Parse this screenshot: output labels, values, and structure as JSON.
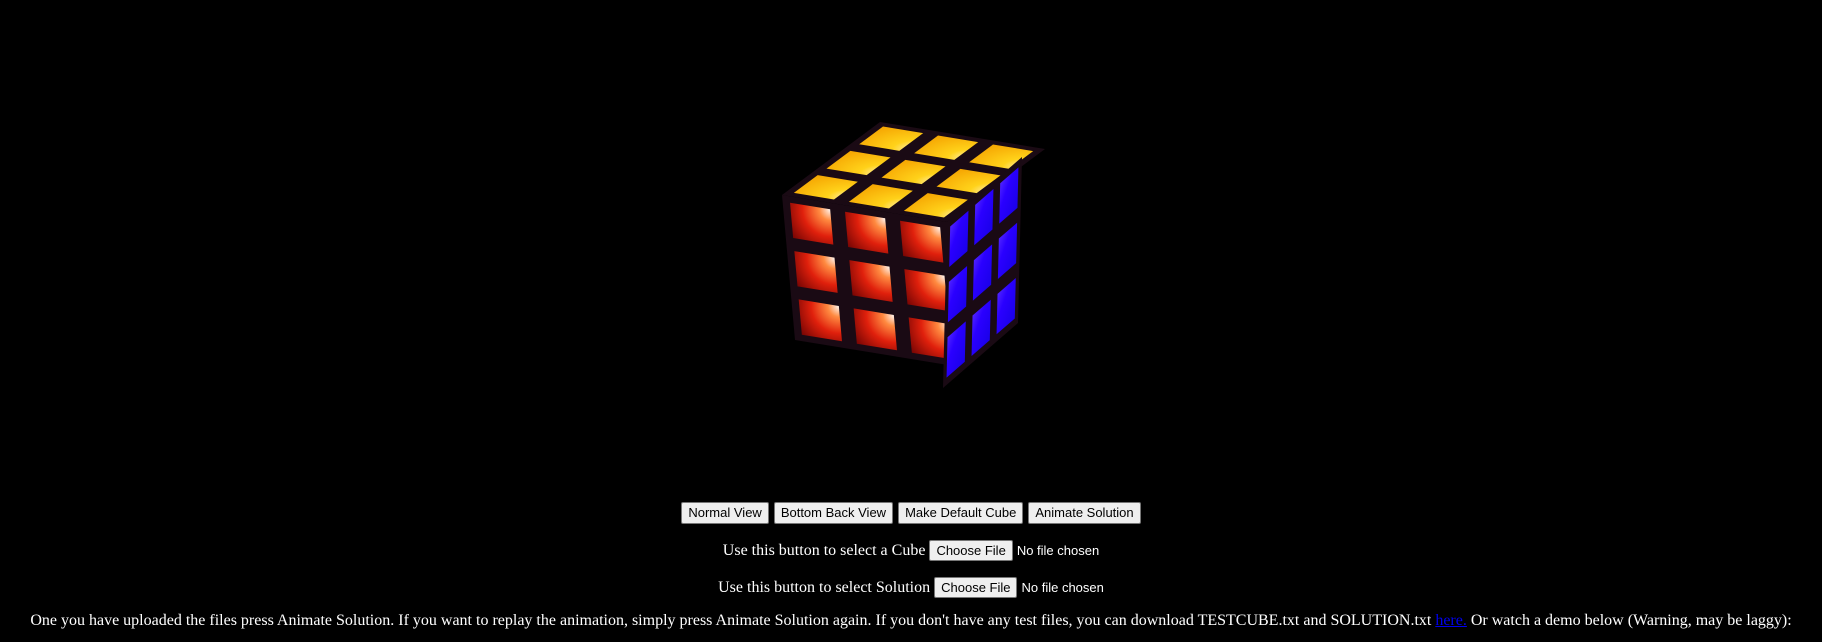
{
  "colors": {
    "background": "#000000",
    "top_face": "#ffc107",
    "front_face": "#d41a0a",
    "right_face": "#1a00ff",
    "gap": "#1a0a14",
    "link": "#0000ee"
  },
  "viewer": {
    "object": "rubiks-cube-3x3"
  },
  "controls": {
    "normal_view": "Normal View",
    "bottom_back_view": "Bottom Back View",
    "make_default_cube": "Make Default Cube",
    "animate_solution": "Animate Solution"
  },
  "cube_upload": {
    "label": "Use this button to select a Cube",
    "button": "Choose File",
    "status": "No file chosen"
  },
  "solution_upload": {
    "label": "Use this button to select Solution",
    "button": "Choose File",
    "status": "No file chosen"
  },
  "info": {
    "text_before": "One you have uploaded the files press Animate Solution. If you want to replay the animation, simply press Animate Solution again. If you don't have any test files, you can download TESTCUBE.txt and SOLUTION.txt",
    "link": "here.",
    "text_after": "Or watch a demo below (Warning, may be laggy):"
  }
}
